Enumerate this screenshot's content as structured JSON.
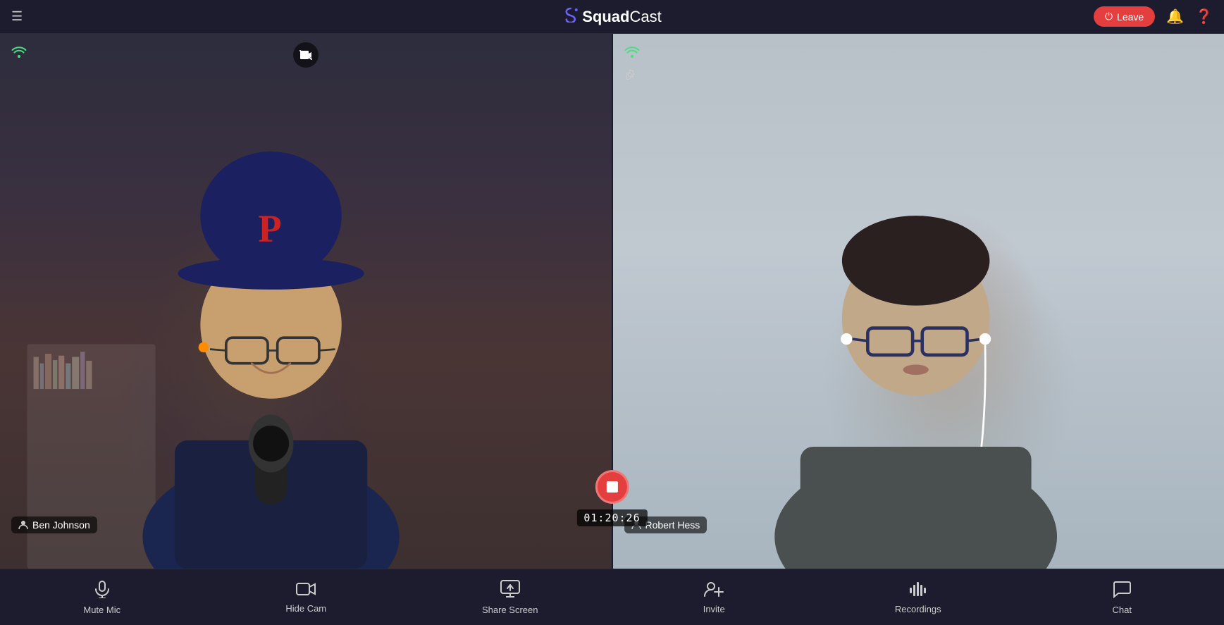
{
  "app": {
    "title": "SquadCast",
    "brand_squad": "Squad",
    "brand_cast": "Cast"
  },
  "nav": {
    "leave_label": "Leave",
    "hamburger": "☰"
  },
  "participants": [
    {
      "id": "left",
      "name": "Ben Johnson",
      "wifi_signal": "📶",
      "has_mic": true,
      "has_cam": true
    },
    {
      "id": "right",
      "name": "Robert Hess",
      "wifi_signal": "📶",
      "has_mic": true,
      "has_cam": true
    }
  ],
  "recording": {
    "timer": "01:20:26",
    "is_recording": true
  },
  "bottom_bar": {
    "items": [
      {
        "id": "mute-mic",
        "label": "Mute Mic",
        "icon": "🎙"
      },
      {
        "id": "hide-cam",
        "label": "Hide Cam",
        "icon": "📹"
      },
      {
        "id": "share-screen",
        "label": "Share Screen",
        "icon": "🖥"
      },
      {
        "id": "invite",
        "label": "Invite",
        "icon": "👥"
      },
      {
        "id": "recordings",
        "label": "Recordings",
        "icon": "🎚"
      },
      {
        "id": "chat",
        "label": "Chat",
        "icon": "💬"
      }
    ]
  }
}
